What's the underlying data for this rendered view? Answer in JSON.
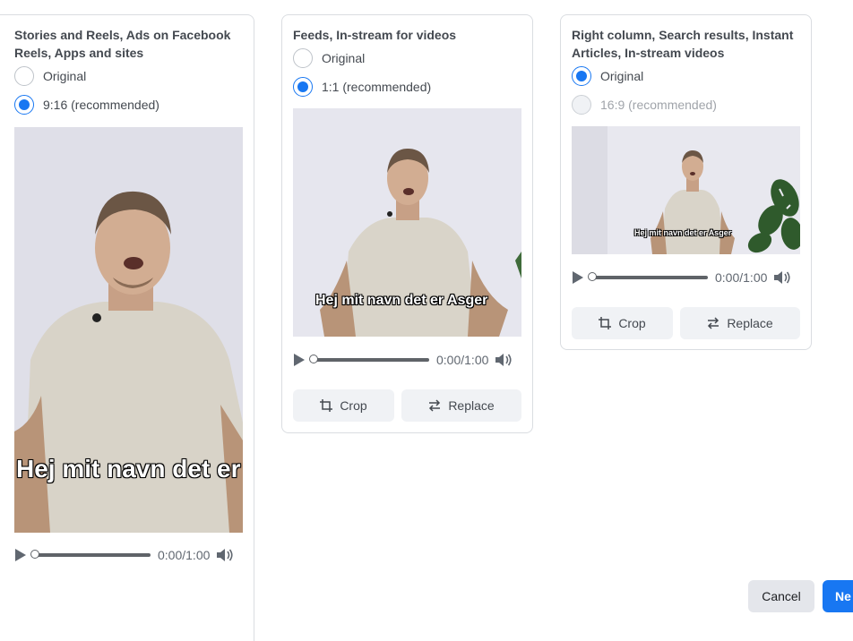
{
  "placements": [
    {
      "title": "Stories and Reels, Ads on Facebook Reels, Apps and sites",
      "options": [
        {
          "label": "Original",
          "checked": false,
          "disabled": false
        },
        {
          "label": "9:16 (recommended)",
          "checked": true,
          "disabled": false
        }
      ],
      "caption": "Hej mit navn det er Asger",
      "player": {
        "time": "0:00/1:00",
        "progress": 0
      }
    },
    {
      "title": "Feeds, In-stream for videos",
      "options": [
        {
          "label": "Original",
          "checked": false,
          "disabled": false
        },
        {
          "label": "1:1 (recommended)",
          "checked": true,
          "disabled": false
        }
      ],
      "caption": "Hej mit navn det er Asger",
      "player": {
        "time": "0:00/1:00",
        "progress": 0
      },
      "actions": {
        "crop": "Crop",
        "replace": "Replace"
      }
    },
    {
      "title": "Right column, Search results, Instant Articles, In-stream videos",
      "options": [
        {
          "label": "Original",
          "checked": true,
          "disabled": false
        },
        {
          "label": "16:9 (recommended)",
          "checked": false,
          "disabled": true
        }
      ],
      "caption": "Hej mit navn det er Asger",
      "player": {
        "time": "0:00/1:00",
        "progress": 0
      },
      "actions": {
        "crop": "Crop",
        "replace": "Replace"
      }
    }
  ],
  "footer": {
    "cancel": "Cancel",
    "next": "Ne"
  },
  "icons": {
    "play": "play-icon",
    "volume": "volume-icon",
    "crop": "crop-icon",
    "replace": "replace-icon"
  },
  "colors": {
    "accent": "#1877f2",
    "button_bg": "#f0f2f5",
    "border": "#dadde1"
  }
}
